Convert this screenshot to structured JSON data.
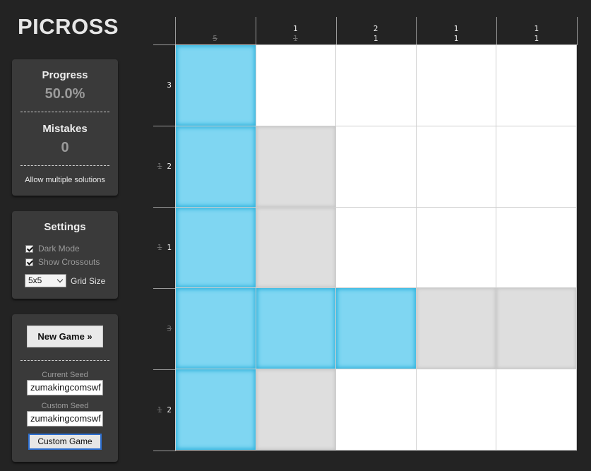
{
  "app": {
    "title": "PICROSS"
  },
  "status": {
    "progress_label": "Progress",
    "progress_value": "50.0%",
    "mistakes_label": "Mistakes",
    "mistakes_value": "0",
    "multi_solutions_label": "Allow multiple solutions"
  },
  "settings": {
    "heading": "Settings",
    "dark_mode_label": "Dark Mode",
    "dark_mode_checked": true,
    "show_crossouts_label": "Show Crossouts",
    "show_crossouts_checked": true,
    "grid_size_value": "5x5",
    "grid_size_label": "Grid Size"
  },
  "game": {
    "new_game_label": "New Game »",
    "current_seed_label": "Current Seed",
    "current_seed_value": "zumakingcomswf",
    "custom_seed_label": "Custom Seed",
    "custom_seed_value": "zumakingcomswf",
    "custom_game_label": "Custom Game"
  },
  "puzzle": {
    "size": 5,
    "column_clues": [
      [
        {
          "n": "5",
          "done": true
        }
      ],
      [
        {
          "n": "1",
          "done": false
        },
        {
          "n": "1",
          "done": true
        }
      ],
      [
        {
          "n": "2",
          "done": false
        },
        {
          "n": "1",
          "done": false
        }
      ],
      [
        {
          "n": "1",
          "done": false
        },
        {
          "n": "1",
          "done": false
        }
      ],
      [
        {
          "n": "1",
          "done": false
        },
        {
          "n": "1",
          "done": false
        }
      ]
    ],
    "row_clues": [
      [
        {
          "n": "3",
          "done": false
        }
      ],
      [
        {
          "n": "1",
          "done": true
        },
        {
          "n": "2",
          "done": false
        }
      ],
      [
        {
          "n": "1",
          "done": true
        },
        {
          "n": "1",
          "done": false
        }
      ],
      [
        {
          "n": "3",
          "done": true
        }
      ],
      [
        {
          "n": "1",
          "done": true
        },
        {
          "n": "2",
          "done": false
        }
      ]
    ],
    "cells": [
      [
        "filled",
        "empty",
        "empty",
        "empty",
        "empty"
      ],
      [
        "filled",
        "crossout",
        "empty",
        "empty",
        "empty"
      ],
      [
        "filled",
        "crossout",
        "empty",
        "empty",
        "empty"
      ],
      [
        "filled",
        "filled",
        "filled",
        "crossout",
        "crossout"
      ],
      [
        "filled",
        "crossout",
        "empty",
        "empty",
        "empty"
      ]
    ]
  }
}
